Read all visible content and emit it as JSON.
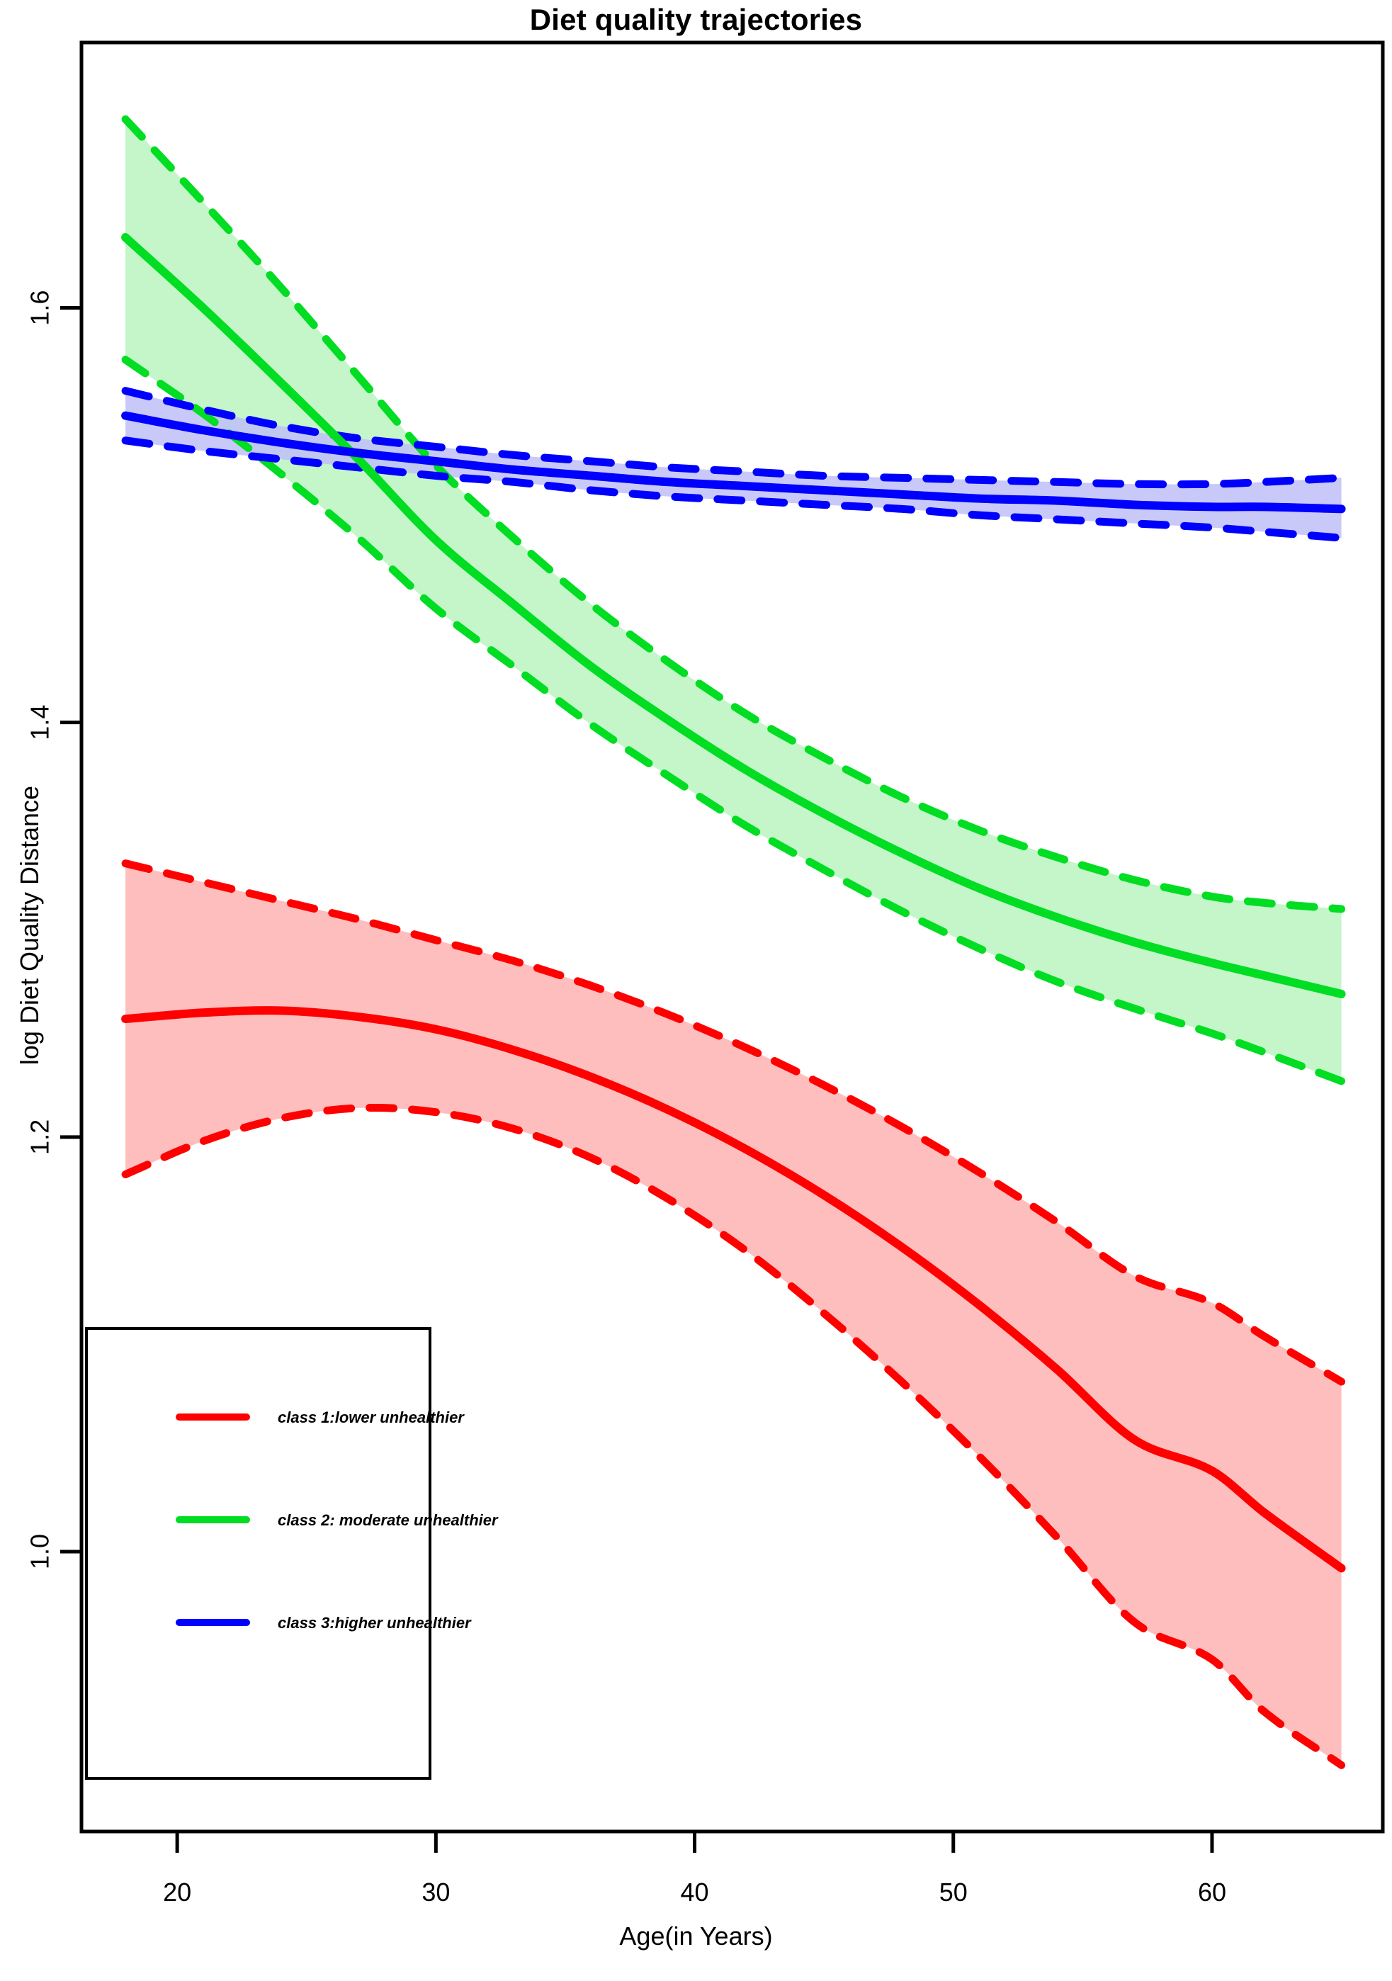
{
  "chart_data": {
    "type": "line",
    "title": "Diet quality trajectories",
    "xlabel": "Age(in Years)",
    "ylabel": "log Diet Quality Distance",
    "xlim": [
      16.3,
      66.6
    ],
    "ylim": [
      0.865,
      1.728
    ],
    "xticks": [
      20,
      30,
      40,
      50,
      60
    ],
    "xticklabels": [
      "20",
      "30",
      "40",
      "50",
      "60"
    ],
    "yticks": [
      1.0,
      1.2,
      1.4,
      1.6
    ],
    "yticklabels": [
      "1.0",
      "1.2",
      "1.4",
      "1.6"
    ],
    "grid": false,
    "legend_position": "bottom-left",
    "x": [
      18,
      21,
      24,
      27,
      30,
      33,
      36,
      39,
      42,
      45,
      48,
      51,
      54,
      57,
      60,
      62,
      65
    ],
    "series": [
      {
        "name": "class 1:lower unhealthier",
        "color": "#ff0000",
        "band_color": "#ffb3b3",
        "values": [
          1.257,
          1.26,
          1.261,
          1.258,
          1.252,
          1.242,
          1.229,
          1.213,
          1.194,
          1.172,
          1.147,
          1.119,
          1.088,
          1.054,
          1.039,
          1.019,
          0.992
        ],
        "upper": [
          1.332,
          1.323,
          1.314,
          1.305,
          1.295,
          1.285,
          1.273,
          1.259,
          1.243,
          1.225,
          1.205,
          1.183,
          1.159,
          1.133,
          1.12,
          1.104,
          1.082
        ],
        "lower": [
          1.182,
          1.198,
          1.209,
          1.214,
          1.212,
          1.204,
          1.19,
          1.17,
          1.145,
          1.115,
          1.082,
          1.046,
          1.007,
          0.966,
          0.948,
          0.923,
          0.897
        ]
      },
      {
        "name": "class 2: moderate unhealthier",
        "color": "#00dd22",
        "band_color": "#baf5c0",
        "values": [
          1.634,
          1.6,
          1.564,
          1.527,
          1.488,
          1.457,
          1.427,
          1.401,
          1.377,
          1.356,
          1.337,
          1.32,
          1.306,
          1.294,
          1.284,
          1.278,
          1.269
        ],
        "upper": [
          1.691,
          1.651,
          1.61,
          1.567,
          1.524,
          1.489,
          1.457,
          1.429,
          1.404,
          1.383,
          1.364,
          1.348,
          1.335,
          1.324,
          1.316,
          1.313,
          1.31
        ],
        "lower": [
          1.575,
          1.549,
          1.52,
          1.489,
          1.455,
          1.427,
          1.399,
          1.374,
          1.35,
          1.329,
          1.309,
          1.291,
          1.275,
          1.262,
          1.25,
          1.241,
          1.227
        ]
      },
      {
        "name": "class 3:higher unhealthier",
        "color": "#0000ff",
        "band_color": "#c0c0f8",
        "values": [
          1.548,
          1.541,
          1.535,
          1.53,
          1.526,
          1.522,
          1.519,
          1.516,
          1.514,
          1.512,
          1.51,
          1.508,
          1.507,
          1.505,
          1.504,
          1.504,
          1.503
        ],
        "upper": [
          1.56,
          1.551,
          1.543,
          1.537,
          1.533,
          1.529,
          1.526,
          1.523,
          1.521,
          1.519,
          1.518,
          1.517,
          1.516,
          1.515,
          1.515,
          1.516,
          1.518
        ],
        "lower": [
          1.536,
          1.531,
          1.527,
          1.523,
          1.519,
          1.516,
          1.512,
          1.509,
          1.507,
          1.505,
          1.503,
          1.5,
          1.498,
          1.496,
          1.494,
          1.492,
          1.489
        ]
      }
    ],
    "legend": [
      {
        "label": "class 1:lower unhealthier",
        "color": "#ff0000"
      },
      {
        "label": "class 2: moderate unhealthier",
        "color": "#00dd22"
      },
      {
        "label": "class 3:higher unhealthier",
        "color": "#0000ff"
      }
    ]
  }
}
